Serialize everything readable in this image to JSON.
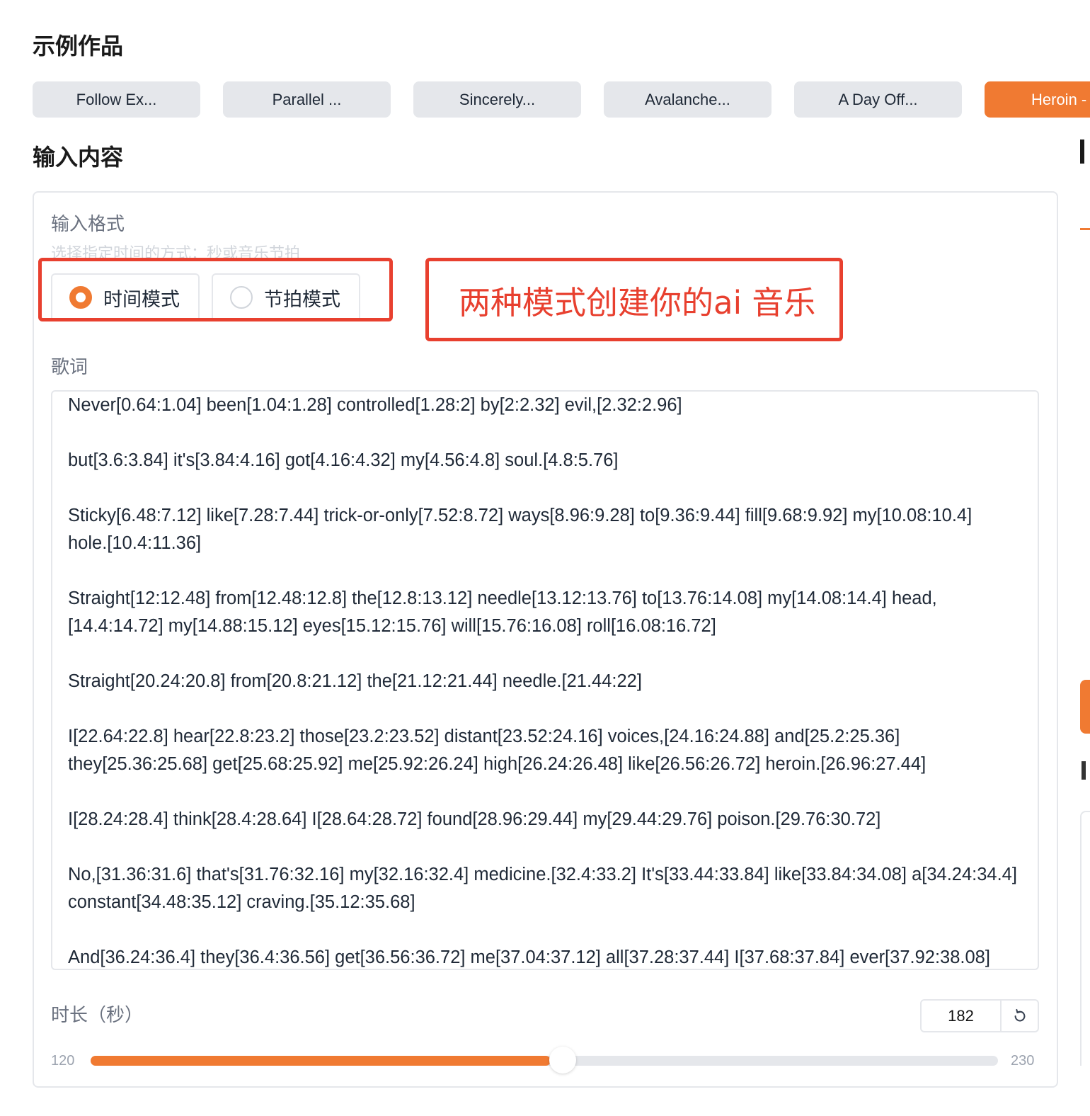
{
  "sections": {
    "examples_title": "示例作品",
    "input_title": "输入内容"
  },
  "examples": [
    {
      "label": "Follow Ex..."
    },
    {
      "label": "Parallel ..."
    },
    {
      "label": "Sincerely..."
    },
    {
      "label": "Avalanche..."
    },
    {
      "label": "A Day Off..."
    },
    {
      "label": "Heroin -",
      "active": true
    }
  ],
  "input_format": {
    "label": "输入格式",
    "hint": "选择指定时间的方式：秒或音乐节拍",
    "options": [
      {
        "label": "时间模式",
        "selected": true
      },
      {
        "label": "节拍模式",
        "selected": false
      }
    ]
  },
  "annotation": {
    "text": "两种模式创建你的ai 音乐",
    "color": "#e8402f"
  },
  "lyrics": {
    "label": "歌词",
    "value": "Never[0.64:1.04] been[1.04:1.28] controlled[1.28:2] by[2:2.32] evil,[2.32:2.96]\n\nbut[3.6:3.84] it's[3.84:4.16] got[4.16:4.32] my[4.56:4.8] soul.[4.8:5.76]\n\nSticky[6.48:7.12] like[7.28:7.44] trick-or-only[7.52:8.72] ways[8.96:9.28] to[9.36:9.44] fill[9.68:9.92] my[10.08:10.4]\nhole.[10.4:11.36]\n\nStraight[12:12.48] from[12.48:12.8] the[12.8:13.12] needle[13.12:13.76] to[13.76:14.08] my[14.08:14.4] head,\n[14.4:14.72] my[14.88:15.12] eyes[15.12:15.76] will[15.76:16.08] roll[16.08:16.72]\n\nStraight[20.24:20.8] from[20.8:21.12] the[21.12:21.44] needle.[21.44:22]\n\nI[22.64:22.8] hear[22.8:23.2] those[23.2:23.52] distant[23.52:24.16] voices,[24.16:24.88] and[25.2:25.36]\nthey[25.36:25.68] get[25.68:25.92] me[25.92:26.24] high[26.24:26.48] like[26.56:26.72] heroin.[26.96:27.44]\n\nI[28.24:28.4] think[28.4:28.64] I[28.64:28.72] found[28.96:29.44] my[29.44:29.76] poison.[29.76:30.72]\n\nNo,[31.36:31.6] that's[31.76:32.16] my[32.16:32.4] medicine.[32.4:33.2] It's[33.44:33.84] like[33.84:34.08] a[34.24:34.4]\nconstant[34.48:35.12] craving.[35.12:35.68]\n\nAnd[36.24:36.4] they[36.4:36.56] get[36.56:36.72] me[37.04:37.12] all[37.28:37.44] I[37.68:37.84] ever[37.92:38.08]"
  },
  "duration": {
    "label": "时长（秒）",
    "value": "182",
    "min": "120",
    "max": "230",
    "current": 182,
    "min_num": 120,
    "max_num": 230,
    "reset_icon": "reset-icon"
  },
  "colors": {
    "accent": "#f07a32",
    "annotation": "#e8402f"
  }
}
